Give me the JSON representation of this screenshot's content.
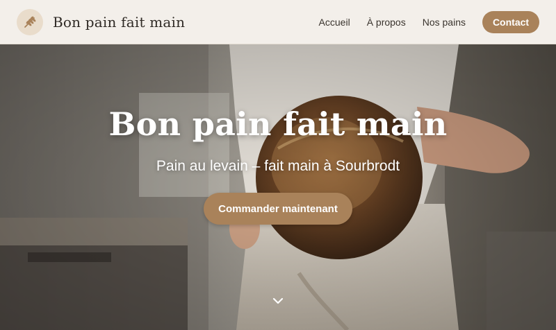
{
  "header": {
    "brand": "Bon pain fait main",
    "logo_icon": "wheat-icon",
    "nav": [
      {
        "label": "Accueil"
      },
      {
        "label": "À propos"
      },
      {
        "label": "Nos pains"
      }
    ],
    "contact_label": "Contact"
  },
  "hero": {
    "title": "Bon pain fait main",
    "subtitle": "Pain au levain – fait main à Sourbrodt",
    "cta_label": "Commander maintenant",
    "scroll_icon": "chevron-down-icon",
    "background_icon": "baker-holding-bread-photo"
  },
  "colors": {
    "accent": "#a9825a",
    "header_bg": "#f3efea",
    "text_dark": "#2f2a25"
  }
}
